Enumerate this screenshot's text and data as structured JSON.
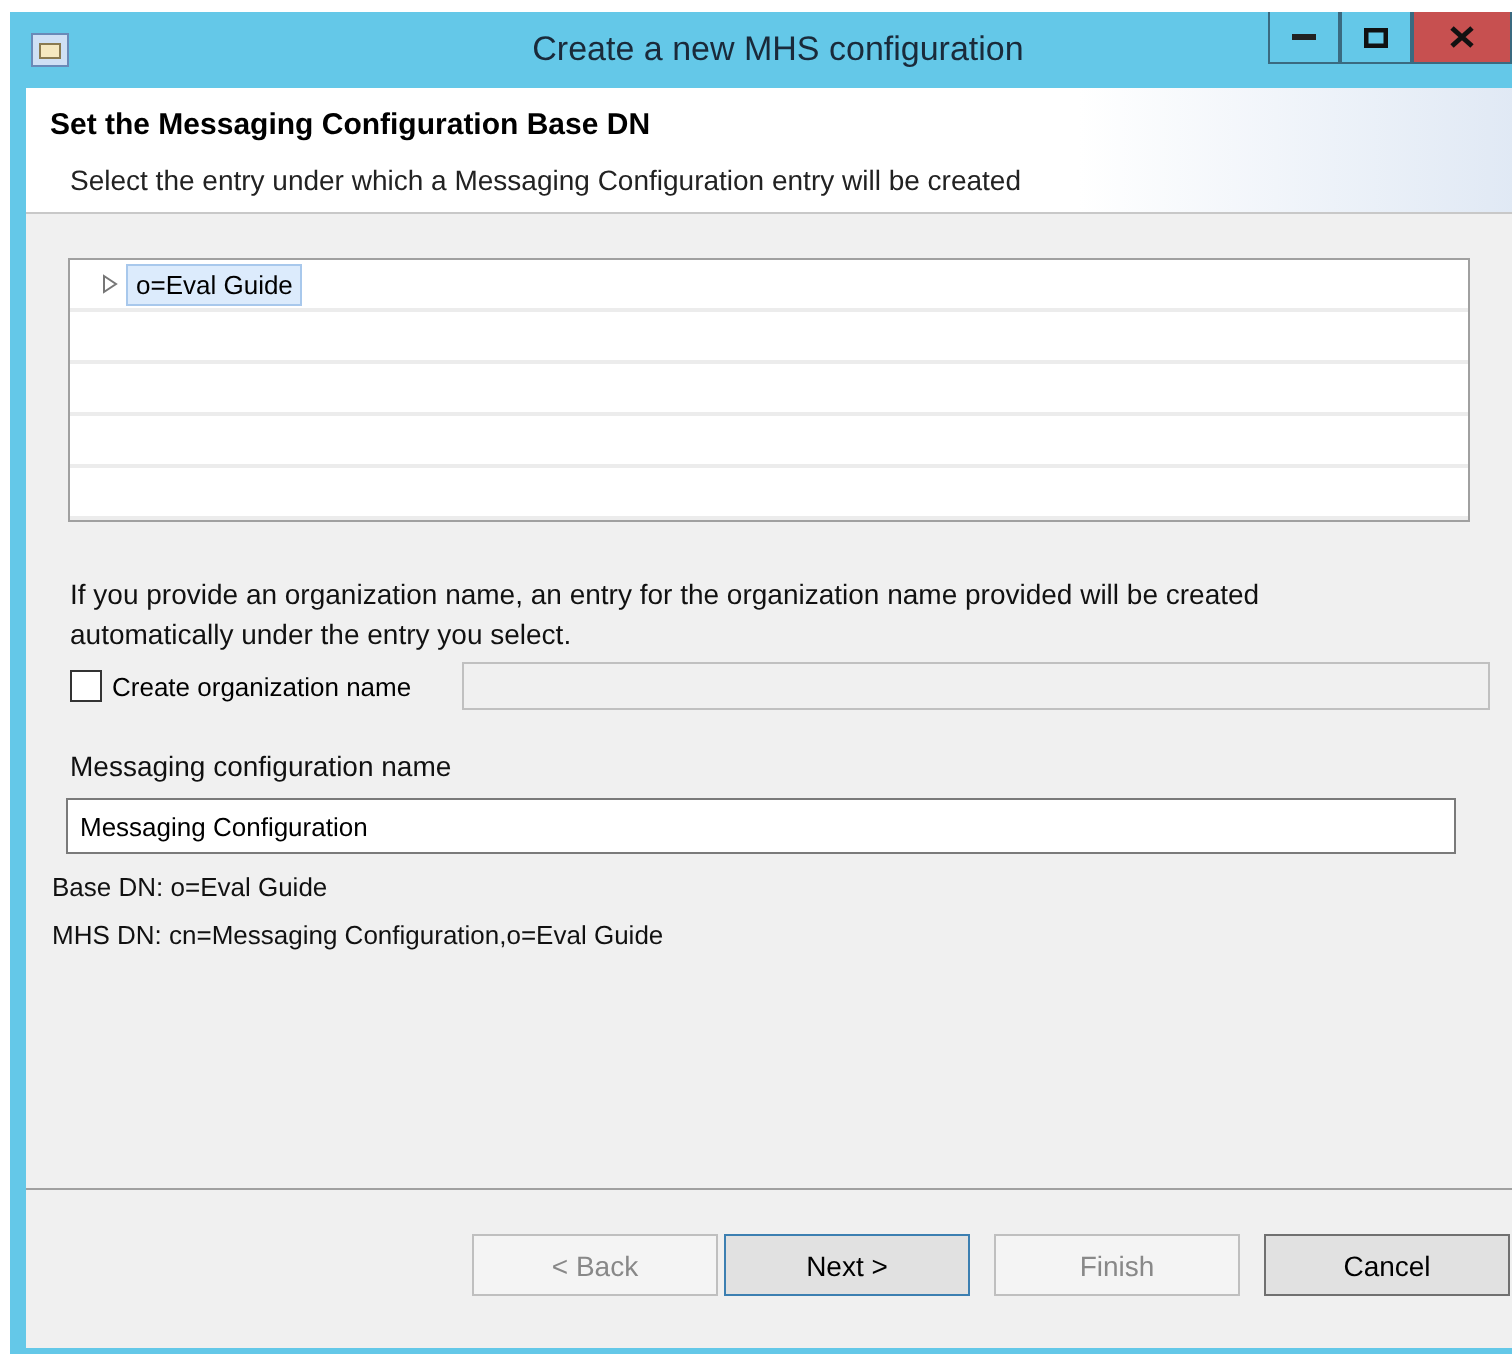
{
  "window": {
    "title": "Create a new MHS configuration"
  },
  "header": {
    "title": "Set the Messaging Configuration Base DN",
    "description": "Select the entry under which a Messaging Configuration entry will be created"
  },
  "tree": {
    "items": [
      {
        "label": "o=Eval Guide",
        "expanded": false,
        "selected": true
      }
    ]
  },
  "organization": {
    "info": "If you provide an organization name, an entry for the organization name provided will be created automatically under the entry you select.",
    "checkbox_label": "Create organization name",
    "checked": false
  },
  "config_name": {
    "label": "Messaging configuration name",
    "value": "Messaging Configuration"
  },
  "base_dn": "Base DN: o=Eval Guide",
  "mhs_dn": "MHS DN: cn=Messaging Configuration,o=Eval Guide",
  "buttons": [
    {
      "label": "< Back",
      "disabled": true,
      "default": false
    },
    {
      "label": "Next >",
      "disabled": false,
      "default": true
    },
    {
      "label": "Finish",
      "disabled": true,
      "default": false
    },
    {
      "label": "Cancel",
      "disabled": false,
      "default": false
    }
  ]
}
